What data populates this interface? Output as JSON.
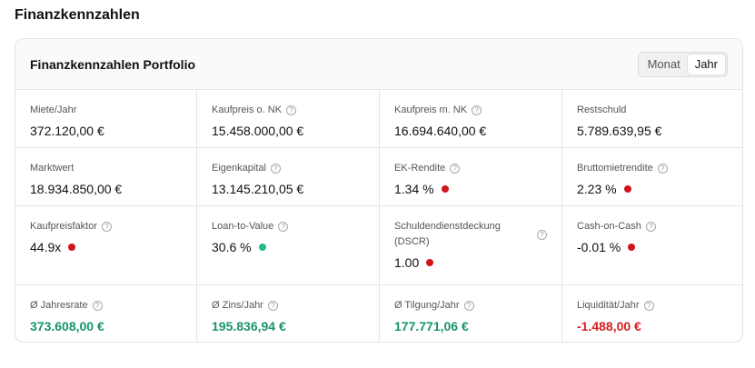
{
  "page": {
    "title": "Finanzkennzahlen"
  },
  "card": {
    "title": "Finanzkennzahlen Portfolio",
    "toggle": {
      "options": [
        "Monat",
        "Jahr"
      ],
      "selected": "Jahr"
    }
  },
  "metrics": {
    "miete_jahr": {
      "label": "Miete/Jahr",
      "value": "372.120,00 €"
    },
    "kaufpreis_o_nk": {
      "label": "Kaufpreis o. NK",
      "value": "15.458.000,00 €"
    },
    "kaufpreis_m_nk": {
      "label": "Kaufpreis m. NK",
      "value": "16.694.640,00 €"
    },
    "restschuld": {
      "label": "Restschuld",
      "value": "5.789.639,95 €"
    },
    "marktwert": {
      "label": "Marktwert",
      "value": "18.934.850,00 €"
    },
    "eigenkapital": {
      "label": "Eigenkapital",
      "value": "13.145.210,05 €"
    },
    "ek_rendite": {
      "label": "EK-Rendite",
      "value": "1.34 %",
      "status": "red"
    },
    "bruttomietrendite": {
      "label": "Bruttomietrendite",
      "value": "2.23 %",
      "status": "red"
    },
    "kaufpreisfaktor": {
      "label": "Kaufpreisfaktor",
      "value": "44.9x",
      "status": "red"
    },
    "loan_to_value": {
      "label": "Loan-to-Value",
      "value": "30.6 %",
      "status": "green"
    },
    "dscr": {
      "label": "Schuldendienstdeckung (DSCR)",
      "value": "1.00",
      "status": "red"
    },
    "cash_on_cash": {
      "label": "Cash-on-Cash",
      "value": "-0.01 %",
      "status": "red"
    },
    "jahresrate": {
      "label": "Ø Jahresrate",
      "value": "373.608,00 €"
    },
    "zins_jahr": {
      "label": "Ø Zins/Jahr",
      "value": "195.836,94 €"
    },
    "tilgung_jahr": {
      "label": "Ø Tilgung/Jahr",
      "value": "177.771,06 €"
    },
    "liquiditaet_jahr": {
      "label": "Liquidität/Jahr",
      "value": "-1.488,00 €"
    }
  },
  "icons": {
    "info": "info-icon",
    "status_dot": "status-dot"
  },
  "colors": {
    "positive": "#17956a",
    "negative": "#d62020",
    "dot_red": "#d0141d",
    "dot_green": "#1fbd7d"
  }
}
